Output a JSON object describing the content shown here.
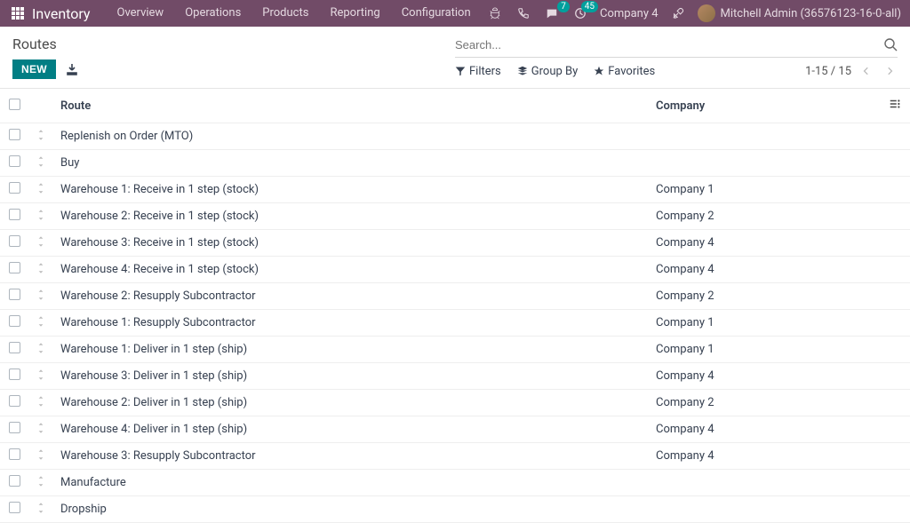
{
  "topbar": {
    "app_title": "Inventory",
    "nav": [
      "Overview",
      "Operations",
      "Products",
      "Reporting",
      "Configuration"
    ],
    "msg_badge": "7",
    "activity_badge": "45",
    "company": "Company 4",
    "user": "Mitchell Admin (36576123-16-0-all)"
  },
  "page": {
    "title": "Routes",
    "new_label": "NEW"
  },
  "search": {
    "placeholder": "Search...",
    "filters_label": "Filters",
    "groupby_label": "Group By",
    "favorites_label": "Favorites",
    "pager": "1-15 / 15"
  },
  "columns": {
    "route": "Route",
    "company": "Company"
  },
  "rows": [
    {
      "route": "Replenish on Order (MTO)",
      "company": ""
    },
    {
      "route": "Buy",
      "company": ""
    },
    {
      "route": "Warehouse 1: Receive in 1 step (stock)",
      "company": "Company 1"
    },
    {
      "route": "Warehouse 2: Receive in 1 step (stock)",
      "company": "Company 2"
    },
    {
      "route": "Warehouse 3: Receive in 1 step (stock)",
      "company": "Company 4"
    },
    {
      "route": "Warehouse 4: Receive in 1 step (stock)",
      "company": "Company 4"
    },
    {
      "route": "Warehouse 2: Resupply Subcontractor",
      "company": "Company 2"
    },
    {
      "route": "Warehouse 1: Resupply Subcontractor",
      "company": "Company 1"
    },
    {
      "route": "Warehouse 1: Deliver in 1 step (ship)",
      "company": "Company 1"
    },
    {
      "route": "Warehouse 3: Deliver in 1 step (ship)",
      "company": "Company 4"
    },
    {
      "route": "Warehouse 2: Deliver in 1 step (ship)",
      "company": "Company 2"
    },
    {
      "route": "Warehouse 4: Deliver in 1 step (ship)",
      "company": "Company 4"
    },
    {
      "route": "Warehouse 3: Resupply Subcontractor",
      "company": "Company 4"
    },
    {
      "route": "Manufacture",
      "company": ""
    },
    {
      "route": "Dropship",
      "company": ""
    }
  ]
}
